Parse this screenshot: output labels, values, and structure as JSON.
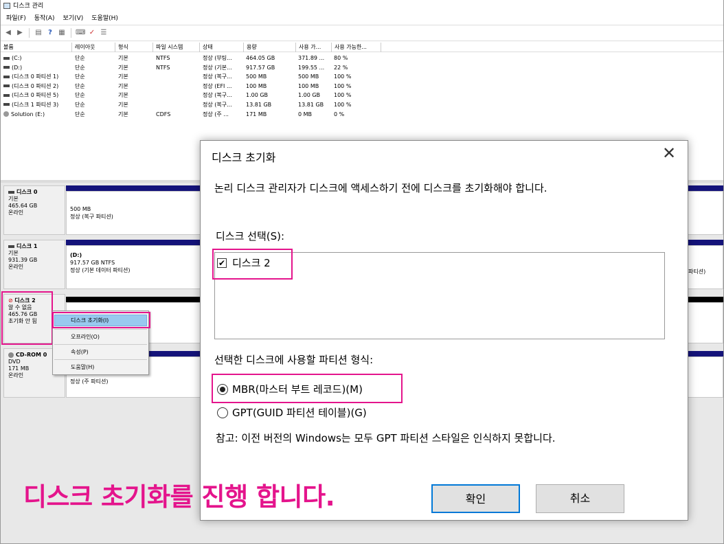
{
  "window": {
    "title": "디스크 관리"
  },
  "menu": [
    "파일(F)",
    "동작(A)",
    "보기(V)",
    "도움말(H)"
  ],
  "toolbar_icons": [
    "back-icon",
    "forward-icon",
    "disk-view-icon",
    "help-icon",
    "properties-icon",
    "connect-icon",
    "check-icon",
    "list-icon"
  ],
  "volume_table": {
    "headers": [
      "볼륨",
      "레이아웃",
      "형식",
      "파일 시스템",
      "상태",
      "용량",
      "사용 가...",
      "사용 가능한..."
    ],
    "rows": [
      [
        "(C:)",
        "단순",
        "기본",
        "NTFS",
        "정상 (부팅...",
        "464.05 GB",
        "371.89 ...",
        "80 %"
      ],
      [
        "(D:)",
        "단순",
        "기본",
        "NTFS",
        "정상 (기본...",
        "917.57 GB",
        "199.55 ...",
        "22 %"
      ],
      [
        "(디스크 0 파티션 1)",
        "단순",
        "기본",
        "",
        "정상 (복구...",
        "500 MB",
        "500 MB",
        "100 %"
      ],
      [
        "(디스크 0 파티션 2)",
        "단순",
        "기본",
        "",
        "정상 (EFI ...",
        "100 MB",
        "100 MB",
        "100 %"
      ],
      [
        "(디스크 0 파티션 5)",
        "단순",
        "기본",
        "",
        "정상 (복구...",
        "1.00 GB",
        "1.00 GB",
        "100 %"
      ],
      [
        "(디스크 1 파티션 3)",
        "단순",
        "기본",
        "",
        "정상 (복구...",
        "13.81 GB",
        "13.81 GB",
        "100 %"
      ],
      [
        "Solution (E:)",
        "단순",
        "기본",
        "CDFS",
        "정상 (주 ...",
        "171 MB",
        "0 MB",
        "0 %"
      ]
    ]
  },
  "disks": [
    {
      "name": "디스크 0",
      "type": "기본",
      "size": "465.64 GB",
      "status": "온라인",
      "part_line1": "500 MB",
      "part_line2": "정상 (복구 파티션)",
      "part_line3": ""
    },
    {
      "name": "디스크 1",
      "type": "기본",
      "size": "931.39 GB",
      "status": "온라인",
      "part_line1": "(D:)",
      "part_line2": "917.57 GB NTFS",
      "part_line3": "정상 (기본 데이터 파티션)",
      "right_fragment": "파티션)"
    },
    {
      "name": "디스크 2",
      "type": "알 수 없음",
      "size": "465.76 GB",
      "status": "초기화 안 됨"
    },
    {
      "name": "CD-ROM 0",
      "type": "DVD",
      "size": "171 MB",
      "status": "온라인",
      "part_line1": "정상 (주 파티션)"
    }
  ],
  "context_menu": [
    "디스크 초기화(I)",
    "오프라인(O)",
    "속성(P)",
    "도움말(H)"
  ],
  "dialog": {
    "title": "디스크 초기화",
    "description": "논리 디스크 관리자가 디스크에 액세스하기 전에 디스크를 초기화해야 합니다.",
    "select_label": "디스크 선택(S):",
    "disk_item": "디스크 2",
    "disk_checked": true,
    "partition_label": "선택한 디스크에 사용할 파티션 형식:",
    "option_mbr": "MBR(마스터 부트 레코드)(M)",
    "option_gpt": "GPT(GUID 파티션 테이블)(G)",
    "selected": "MBR",
    "note": "참고: 이전 버전의 Windows는 모두 GPT 파티션 스타일은 인식하지 못합니다.",
    "ok": "확인",
    "cancel": "취소"
  },
  "caption": "디스크 초기화를 진행 합니다.",
  "colors": {
    "highlight": "#e4148c",
    "partition_bar": "#14137a",
    "context_selected": "#99c9ef"
  }
}
